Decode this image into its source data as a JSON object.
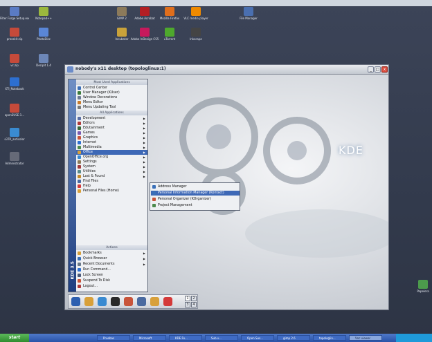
{
  "host_desktop_icons": [
    {
      "label": "Filter Forge Setup.exe",
      "color": "#5a7bc4"
    },
    {
      "label": "Notepad++",
      "color": "#9bb83d"
    },
    {
      "label": "GIMP 2",
      "color": "#8c7a5b"
    },
    {
      "label": "Adobe Acrobat",
      "color": "#b31f24"
    },
    {
      "label": "Mozilla Firefox",
      "color": "#e06e1c"
    },
    {
      "label": "VLC media player",
      "color": "#f08a00"
    },
    {
      "label": "File Manager",
      "color": "#4a6fb0"
    },
    {
      "label": "presskit.zip",
      "color": "#c54a3a"
    },
    {
      "label": "PhotoDisc",
      "color": "#5a86d6"
    },
    {
      "label": "Incubator",
      "color": "#c9a23a"
    },
    {
      "label": "Adobe InDesign CS5",
      "color": "#c71a5c"
    },
    {
      "label": "uTorrent",
      "color": "#4ea82d"
    },
    {
      "label": "Inkscape",
      "color": "#444444"
    },
    {
      "label": "vc.zip",
      "color": "#c54a3a"
    },
    {
      "label": "Decipit 1.4",
      "color": "#6d87b8"
    },
    {
      "label": "XTI_Notebook",
      "color": "#2d6fd1"
    },
    {
      "label": "openSUSE-1...",
      "color": "#c54a3a"
    },
    {
      "label": "s3TR_anticolor",
      "color": "#3a8bd1"
    },
    {
      "label": "Administrator",
      "color": "#666a78"
    },
    {
      "label": "Papelera",
      "color": "#4c9a4c"
    }
  ],
  "vnc_window": {
    "title": "nobody's x11 desktop (topologlinux:1)",
    "minimize_label": "_",
    "maximize_label": "□",
    "close_label": "x"
  },
  "kde_logo": "KDE",
  "kmenu": {
    "sidebar_text": "KDE 3.5",
    "headers": {
      "most_used": "Most Used Applications",
      "all_apps": "All Applications",
      "actions": "Actions"
    },
    "most_used": [
      {
        "label": "Control Center",
        "color": "#3c70b8"
      },
      {
        "label": "User Manager (KUser)",
        "color": "#3a7a3a"
      },
      {
        "label": "Window Decorations",
        "color": "#6d7a92"
      },
      {
        "label": "Menu Editor",
        "color": "#c87a2a"
      },
      {
        "label": "Menu Updating Tool",
        "color": "#7a7a7a"
      }
    ],
    "all_apps": [
      {
        "label": "Development",
        "color": "#5a6fa5",
        "submenu": true
      },
      {
        "label": "Editors",
        "color": "#b03a3a",
        "submenu": true
      },
      {
        "label": "Edutainment",
        "color": "#3a6a3a",
        "submenu": true
      },
      {
        "label": "Games",
        "color": "#7a5ab0",
        "submenu": true
      },
      {
        "label": "Graphics",
        "color": "#c8543a",
        "submenu": true
      },
      {
        "label": "Internet",
        "color": "#2d6fd1",
        "submenu": true
      },
      {
        "label": "Multimedia",
        "color": "#4c8a4c",
        "submenu": true
      },
      {
        "label": "Office",
        "color": "#d8a03a",
        "submenu": true,
        "highlighted": true
      },
      {
        "label": "OpenOffice.org",
        "color": "#3a8ad1",
        "submenu": true
      },
      {
        "label": "Settings",
        "color": "#8a7a5a",
        "submenu": true
      },
      {
        "label": "System",
        "color": "#a33a3a",
        "submenu": true
      },
      {
        "label": "Utilities",
        "color": "#5a8a8a",
        "submenu": true
      },
      {
        "label": "Lost & Found",
        "color": "#c48a2a",
        "submenu": true
      },
      {
        "label": "Find Files",
        "color": "#4a6aa0",
        "submenu": false
      },
      {
        "label": "Help",
        "color": "#d43a3a",
        "submenu": false
      },
      {
        "label": "Personal Files (Home)",
        "color": "#d8a03a",
        "submenu": false
      }
    ],
    "actions": [
      {
        "label": "Bookmarks",
        "color": "#d8a03a",
        "submenu": true
      },
      {
        "label": "Quick Browser",
        "color": "#3a70b8",
        "submenu": true
      },
      {
        "label": "Recent Documents",
        "color": "#6a7a8a",
        "submenu": true
      },
      {
        "label": "Run Command...",
        "color": "#2d6fd1",
        "submenu": false
      },
      {
        "label": "Lock Screen",
        "color": "#4a5a7a",
        "submenu": false
      },
      {
        "label": "Suspend To Disk",
        "color": "#c8543a",
        "submenu": false
      },
      {
        "label": "Logout...",
        "color": "#b03a3a",
        "submenu": false
      }
    ]
  },
  "office_submenu": [
    {
      "label": "Address Manager",
      "color": "#3a70b8"
    },
    {
      "label": "Personal Information Manager (Kontact)",
      "color": "#3a70b8",
      "highlighted": true
    },
    {
      "label": "Personal Organizer (KOrganizer)",
      "color": "#c8543a"
    },
    {
      "label": "Project Management",
      "color": "#4c8a4c"
    }
  ],
  "kicker_panel": {
    "icons": [
      {
        "name": "kmenu",
        "color": "#2d5fb0"
      },
      {
        "name": "home",
        "color": "#d8a03a"
      },
      {
        "name": "konqueror",
        "color": "#3a8ad1"
      },
      {
        "name": "terminal",
        "color": "#2a2a2a"
      },
      {
        "name": "browser",
        "color": "#c8543a"
      },
      {
        "name": "kmail",
        "color": "#4a6aa0"
      },
      {
        "name": "office",
        "color": "#d8a03a"
      },
      {
        "name": "help",
        "color": "#d43a3a"
      }
    ],
    "pager": [
      "1",
      "2",
      "3",
      "4"
    ]
  },
  "host_taskbar": {
    "start_label": "start",
    "buttons": [
      "Pruebas",
      "Microsoft",
      "KDE Fo...",
      "Sub v...",
      "Open Sus...",
      "gimp 2.6",
      "topologlin...",
      "Vnc viewer"
    ]
  }
}
